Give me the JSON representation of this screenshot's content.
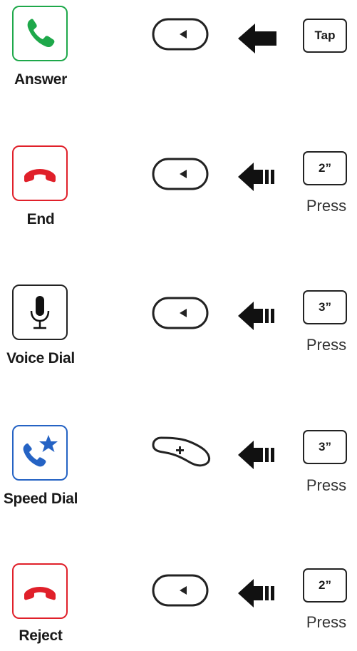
{
  "colors": {
    "answer": "#1ea84a",
    "end": "#e0202a",
    "voice": "#111111",
    "speed": "#2563c4",
    "outline": "#222222"
  },
  "rows": [
    {
      "label": "Answer",
      "icon": "phone-answer-icon",
      "button": "button-left-arrow",
      "action_key": "Tap",
      "action_note": ""
    },
    {
      "label": "End",
      "icon": "phone-hangup-icon",
      "button": "button-left-arrow",
      "action_key": "2”",
      "action_note": "Press"
    },
    {
      "label": "Voice Dial",
      "icon": "microphone-icon",
      "button": "button-left-arrow",
      "action_key": "3”",
      "action_note": "Press"
    },
    {
      "label": "Speed Dial",
      "icon": "phone-star-icon",
      "button": "button-plus",
      "action_key": "3”",
      "action_note": "Press"
    },
    {
      "label": "Reject",
      "icon": "phone-hangup-icon",
      "button": "button-left-arrow",
      "action_key": "2”",
      "action_note": "Press"
    }
  ]
}
